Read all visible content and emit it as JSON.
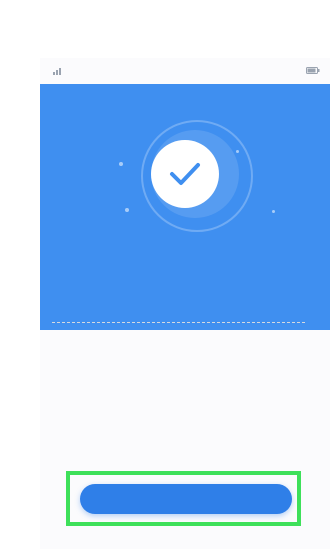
{
  "status_bar": {
    "carrier": "",
    "right_info": ""
  },
  "hero": {
    "title": "",
    "caption": ""
  },
  "details": {
    "title": "",
    "items": []
  },
  "actions": {
    "done_label": ""
  },
  "colors": {
    "accent": "#3f8ff0",
    "button": "#2f7fe8",
    "highlight": "#3ee05a"
  },
  "icons": {
    "status": "check-icon"
  }
}
